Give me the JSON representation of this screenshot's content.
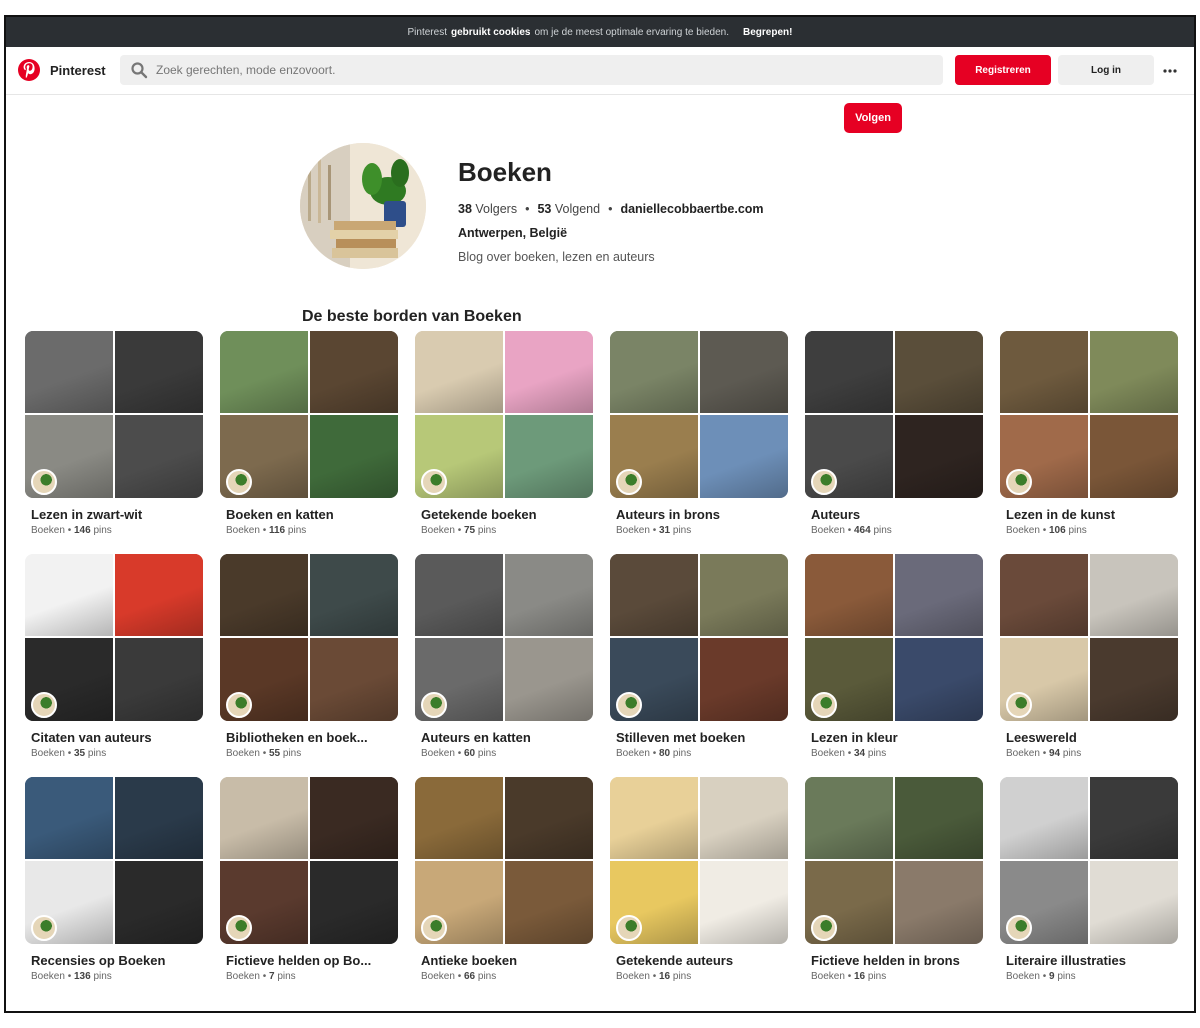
{
  "cookie_bar": {
    "text_before": "Pinterest",
    "bold": "gebruikt cookies",
    "text_after": "om je de meest optimale ervaring te bieden.",
    "accept": "Begrepen!"
  },
  "header": {
    "brand": "Pinterest",
    "search_placeholder": "Zoek gerechten, mode enzovoort.",
    "register": "Registreren",
    "login": "Log in"
  },
  "profile": {
    "follow": "Volgen",
    "name": "Boeken",
    "followers_count": "38",
    "followers_label": "Volgers",
    "following_count": "53",
    "following_label": "Volgend",
    "website": "daniellecobbaertbe.com",
    "location": "Antwerpen, België",
    "bio": "Blog over boeken, lezen en auteurs"
  },
  "section_title": "De beste borden van Boeken",
  "boards": [
    {
      "title": "Lezen in zwart-wit",
      "owner": "Boeken",
      "pins": "146",
      "colors": [
        "#6b6b6b",
        "#3a3a3a",
        "#8a8a84",
        "#4c4c4c"
      ]
    },
    {
      "title": "Boeken en katten",
      "owner": "Boeken",
      "pins": "116",
      "colors": [
        "#6f8f5a",
        "#5a4632",
        "#7d6a4e",
        "#3f6a3a"
      ]
    },
    {
      "title": "Getekende boeken",
      "owner": "Boeken",
      "pins": "75",
      "colors": [
        "#d9cbb0",
        "#e9a4c4",
        "#b7c878",
        "#6d9a7a"
      ]
    },
    {
      "title": "Auteurs in brons",
      "owner": "Boeken",
      "pins": "31",
      "colors": [
        "#7a8466",
        "#5d5a52",
        "#9a7e4e",
        "#6d8fb8"
      ]
    },
    {
      "title": "Auteurs",
      "owner": "Boeken",
      "pins": "464",
      "colors": [
        "#3e3e3e",
        "#5a4e3a",
        "#4a4a4a",
        "#2e2420"
      ]
    },
    {
      "title": "Lezen in de kunst",
      "owner": "Boeken",
      "pins": "106",
      "colors": [
        "#6e5a3e",
        "#7f8a5a",
        "#a06a4a",
        "#7a5638"
      ]
    },
    {
      "title": "Citaten van auteurs",
      "owner": "Boeken",
      "pins": "35",
      "colors": [
        "#f2f2f2",
        "#d83a2a",
        "#2a2a2a",
        "#3a3a3a"
      ]
    },
    {
      "title": "Bibliotheken en boek...",
      "owner": "Boeken",
      "pins": "55",
      "colors": [
        "#4a3a2a",
        "#3e4a4a",
        "#5a3826",
        "#6a4a36"
      ]
    },
    {
      "title": "Auteurs en katten",
      "owner": "Boeken",
      "pins": "60",
      "colors": [
        "#5a5a5a",
        "#8a8a86",
        "#6a6a6a",
        "#9a968e"
      ]
    },
    {
      "title": "Stilleven met boeken",
      "owner": "Boeken",
      "pins": "80",
      "colors": [
        "#5a4a3a",
        "#7a7a5a",
        "#3a4a5a",
        "#6a3a2a"
      ]
    },
    {
      "title": "Lezen in kleur",
      "owner": "Boeken",
      "pins": "34",
      "colors": [
        "#8a5a3a",
        "#6a6a7a",
        "#5a5a3a",
        "#3a4a6a"
      ]
    },
    {
      "title": "Leeswereld",
      "owner": "Boeken",
      "pins": "94",
      "colors": [
        "#6a4a3a",
        "#c8c4bc",
        "#d8c8a8",
        "#4a3a2e"
      ]
    },
    {
      "title": "Recensies op Boeken",
      "owner": "Boeken",
      "pins": "136",
      "colors": [
        "#3a5a7a",
        "#2a3a4a",
        "#e8e8e8",
        "#2a2a2a"
      ]
    },
    {
      "title": "Fictieve helden op Bo...",
      "owner": "Boeken",
      "pins": "7",
      "colors": [
        "#c8bca8",
        "#3a2a22",
        "#5a3a2e",
        "#2a2a2a"
      ]
    },
    {
      "title": "Antieke boeken",
      "owner": "Boeken",
      "pins": "66",
      "colors": [
        "#8a6a3a",
        "#4a3a2a",
        "#c8a878",
        "#7a5a3a"
      ]
    },
    {
      "title": "Getekende auteurs",
      "owner": "Boeken",
      "pins": "16",
      "colors": [
        "#e8d098",
        "#d8d0c0",
        "#e8c860",
        "#f0ece4"
      ]
    },
    {
      "title": "Fictieve helden in brons",
      "owner": "Boeken",
      "pins": "16",
      "colors": [
        "#6a7a5a",
        "#4a5a3a",
        "#7a6a4a",
        "#8a7a6a"
      ]
    },
    {
      "title": "Literaire illustraties",
      "owner": "Boeken",
      "pins": "9",
      "colors": [
        "#d0d0d0",
        "#3a3a3a",
        "#8a8a8a",
        "#e0dcd4"
      ]
    }
  ],
  "pins_label": "pins",
  "colors": {
    "accent": "#e60023",
    "cookie_bar": "#2b2f33",
    "button_gray": "#efefef"
  },
  "icons": {
    "logo": "pinterest-logo-icon",
    "search": "search-icon",
    "more": "more-dots-icon"
  }
}
